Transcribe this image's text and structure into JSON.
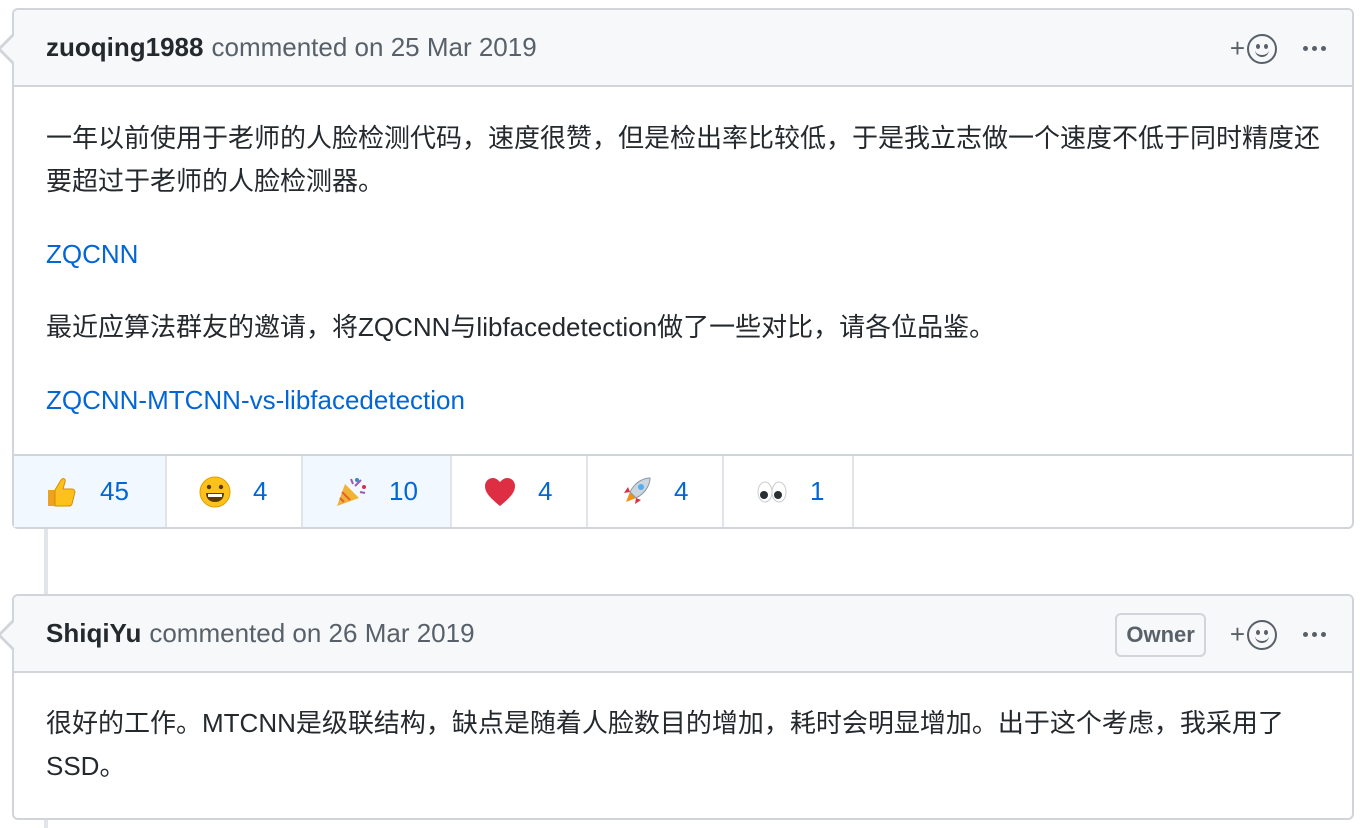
{
  "comments": [
    {
      "author": "zuoqing1988",
      "meta": "commented on 25 Mar 2019",
      "body": {
        "p1": "一年以前使用于老师的人脸检测代码，速度很赞，但是检出率比较低，于是我立志做一个速度不低于同时精度还要超过于老师的人脸检测器。",
        "link1": "ZQCNN",
        "p2": "最近应算法群友的邀请，将ZQCNN与libfacedetection做了一些对比，请各位品鉴。",
        "link2": "ZQCNN-MTCNN-vs-libfacedetection"
      },
      "reactions": [
        {
          "icon": "thumbs-up",
          "count": "45",
          "active": true
        },
        {
          "icon": "grinning-face",
          "count": "4",
          "active": false
        },
        {
          "icon": "party-popper",
          "count": "10",
          "active": true
        },
        {
          "icon": "red-heart",
          "count": "4",
          "active": false
        },
        {
          "icon": "rocket",
          "count": "4",
          "active": false
        },
        {
          "icon": "eyes",
          "count": "1",
          "active": false
        }
      ]
    },
    {
      "author": "ShiqiYu",
      "meta": "commented on 26 Mar 2019",
      "badge": "Owner",
      "body": {
        "p1": "很好的工作。MTCNN是级联结构，缺点是随着人脸数目的增加，耗时会明显增加。出于这个考虑，我采用了SSD。"
      }
    }
  ],
  "actions": {
    "add_reaction": "+",
    "more": "more-options"
  },
  "colors": {
    "link": "#0366d6",
    "header_bg": "#f6f8fa",
    "border": "#d1d5da",
    "active_reaction": "#f1f8ff"
  }
}
